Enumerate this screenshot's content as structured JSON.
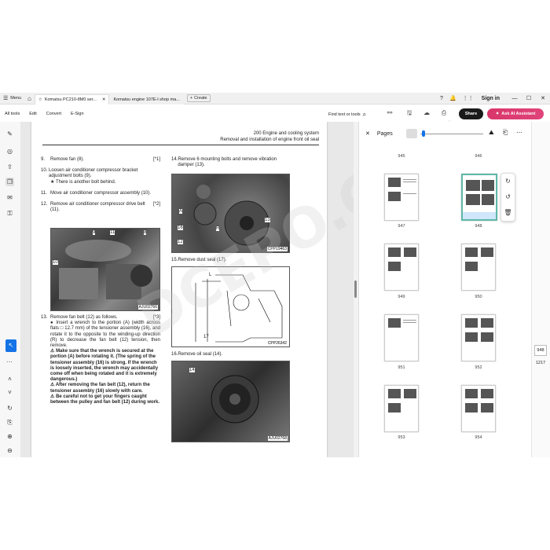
{
  "tabbar": {
    "menu_label": "Menu",
    "tabs": [
      {
        "label": "Komatsu PC210-8M0 ser..."
      },
      {
        "label": "Komatsu engine 107E-l shop ma..."
      }
    ],
    "create_label": "Create",
    "signin_label": "Sign in"
  },
  "toolbar": {
    "items": [
      "All tools",
      "Edit",
      "Convert",
      "E-Sign"
    ],
    "find_label": "Find text or tools",
    "share_label": "Share",
    "ai_label": "Ask AI Assistant"
  },
  "page": {
    "header_line1": "200 Engine and cooling system",
    "header_line2": "Removal and installation of engine front oil seal",
    "left_steps": [
      {
        "num": "9.",
        "text": "Remove fan (8).",
        "ref": "[*1]"
      },
      {
        "num": "10.",
        "text": "Loosen air conditioner compressor bracket adjustment bolts (9).",
        "ref": "",
        "bullet": "There is another bolt behind."
      },
      {
        "num": "11.",
        "text": "Move air conditioner compressor assembly (10).",
        "ref": ""
      },
      {
        "num": "12.",
        "text": "Remove air conditioner compressor drive belt (11).",
        "ref": "[*2]"
      }
    ],
    "step13": {
      "num": "13.",
      "text": "Remove fan belt (12) as follows.",
      "ref": "[*3]",
      "bullet": "Insert a wrench to the portion (A) (width across flats □ 12.7 mm) of the tensioner assembly (16), and rotate it to the opposite to the winding-up direction (R) to decrease the fan belt (12) tension, then remove.",
      "warnings": [
        "Make sure that the wrench is secured at the portion (A) before rotating it. (The spring of the tensioner assembly (16) is strong. If the wrench is loosely inserted, the wrench may accidentally come off when being rotated and it is extremely dangerous.)",
        "After removing the fan belt (12), return the tensioner assembly (16) slowly with care.",
        "Be careful not to get your fingers caught between the pulley and fan belt (12) during work."
      ]
    },
    "right_steps": [
      {
        "num": "14.",
        "text": "Remove 6 mounting bolts and remove vibration damper (13)."
      },
      {
        "num": "15.",
        "text": "Remove dust seal (17)."
      },
      {
        "num": "16.",
        "text": "Remove oil seal (14)."
      }
    ],
    "photo_captions": [
      "AJU02766",
      "CPP19463",
      "CPP26342",
      "AJU02768"
    ],
    "photo1_labels": [
      "9",
      "11",
      "8",
      "10"
    ],
    "photo2_labels": [
      "A",
      "16",
      "R",
      "12",
      "13"
    ],
    "photo3_labels": [
      "L",
      "17"
    ],
    "photo4_labels": [
      "14"
    ],
    "bullet_mark": "★"
  },
  "panel": {
    "title": "Pages",
    "page_numbers": [
      "945",
      "946",
      "947",
      "948",
      "949",
      "950",
      "951",
      "952",
      "953",
      "954"
    ]
  },
  "nav": {
    "current_page": "948",
    "total_pages": "1217"
  },
  "watermark": "DCEPO.COM",
  "colors": {
    "accent": "#1473e6",
    "ai_button": "#d9366b",
    "selected_thumb": "#5fb8a8"
  }
}
